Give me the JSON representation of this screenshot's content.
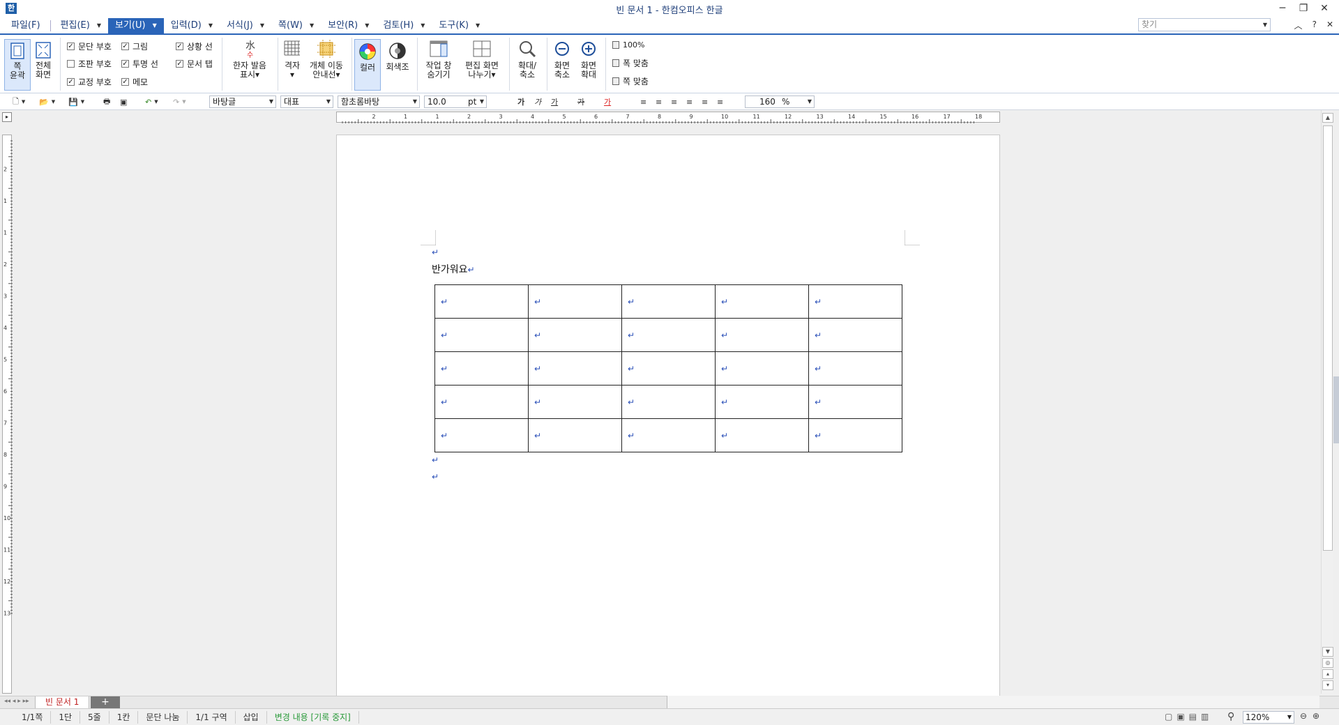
{
  "window": {
    "title": "빈 문서 1 - 한컴오피스 한글",
    "minimize": "─",
    "restore": "❐",
    "close": "✕"
  },
  "menu": {
    "items": [
      {
        "label": "파일(F)",
        "arrow": false
      },
      {
        "label": "편집(E)",
        "arrow": true
      },
      {
        "label": "보기(U)",
        "arrow": true,
        "active": true
      },
      {
        "label": "입력(D)",
        "arrow": true
      },
      {
        "label": "서식(J)",
        "arrow": true
      },
      {
        "label": "쪽(W)",
        "arrow": true
      },
      {
        "label": "보안(R)",
        "arrow": true
      },
      {
        "label": "검토(H)",
        "arrow": true
      },
      {
        "label": "도구(K)",
        "arrow": true
      }
    ],
    "help_placeholder": "찾기",
    "collapse": "︿",
    "help_icon": "?",
    "close_doc": "✕"
  },
  "ribbon": {
    "page_outline": "쪽\n윤곽",
    "full_screen": "전체\n화면",
    "checks": {
      "para_mark": "문단 부호",
      "picture": "그림",
      "status_line": "상황 선",
      "layout_mark": "조판 부호",
      "transparent_line": "투명 선",
      "doc_tab": "문서 탭",
      "proof_mark": "교정 부호",
      "memo": "메모"
    },
    "hanja_pron": "한자 발음\n표시▾",
    "grid": "격자\n▾",
    "object_guide": "개체 이동\n안내선▾",
    "color": "컬러",
    "grayscale": "회색조",
    "hide_task": "작업 창\n숨기기",
    "split_view": "편집 화면\n나누기▾",
    "zoom": "확대/\n축소",
    "zoom_out": "화면\n축소",
    "zoom_in": "화면\n확대",
    "zoom_100": "100%",
    "fit_width": "폭 맞춤",
    "fit_page": "쪽 맞춤"
  },
  "toolbar": {
    "style": "바탕글",
    "lang": "대표",
    "font": "함초롬바탕",
    "size": "10.0",
    "unit": "pt",
    "bold": "가",
    "italic": "가",
    "underline": "가",
    "strike": "가",
    "color_text": "가",
    "line_spacing": "160",
    "percent": "%"
  },
  "ruler": {
    "h_ticks": [
      "2",
      "1",
      "1",
      "2",
      "3",
      "4",
      "5",
      "6",
      "7",
      "8",
      "9",
      "10",
      "11",
      "12",
      "13",
      "14",
      "15",
      "16",
      "17",
      "18"
    ],
    "v_ticks": [
      "2",
      "1",
      "1",
      "2",
      "3",
      "4",
      "5",
      "6",
      "7",
      "8",
      "9",
      "10",
      "11",
      "12",
      "13"
    ]
  },
  "document": {
    "para_mark": "↵",
    "greeting": "반가워요",
    "table": {
      "rows": 5,
      "cols": 5
    }
  },
  "tabs": {
    "doc": "빈 문서 1",
    "add": "+"
  },
  "status": {
    "items": [
      "1/1쪽",
      "1단",
      "5줄",
      "1칸",
      "문단 나눔",
      "1/1 구역",
      "삽입"
    ],
    "track_changes": "변경 내용 [기록 중지]",
    "zoom": "120%"
  }
}
